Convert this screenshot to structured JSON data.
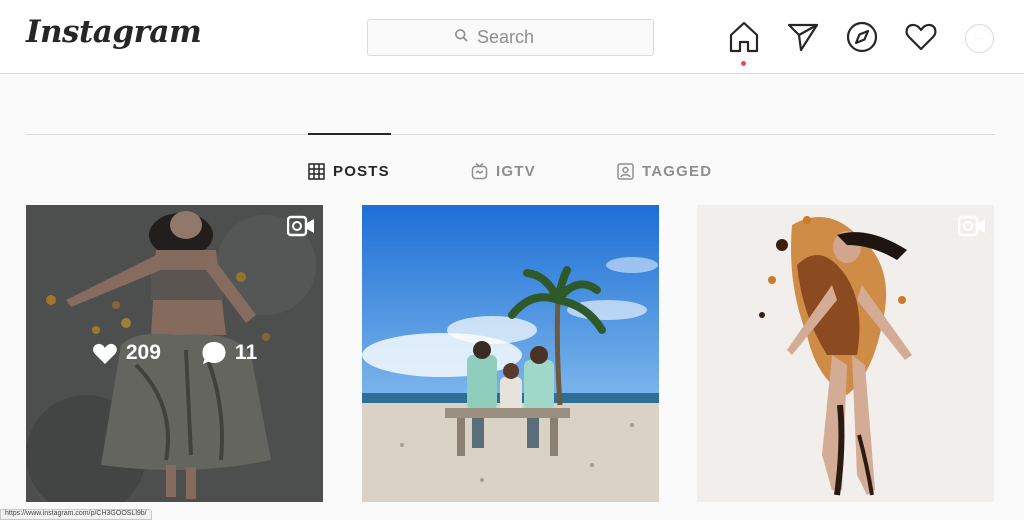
{
  "header": {
    "logo_text": "Instagram",
    "search": {
      "placeholder": "Search",
      "icon": "search-icon"
    },
    "nav_icons": [
      "home-icon",
      "direct-message-icon",
      "explore-icon",
      "activity-heart-icon",
      "profile-avatar"
    ],
    "home_notification_color": "#ed4956"
  },
  "tabs": [
    {
      "label": "POSTS",
      "icon": "grid-icon",
      "active": true
    },
    {
      "label": "IGTV",
      "icon": "igtv-icon",
      "active": false
    },
    {
      "label": "TAGGED",
      "icon": "tagged-icon",
      "active": false
    }
  ],
  "posts": [
    {
      "type": "video",
      "likes": "209",
      "comments": "11",
      "hover": true
    },
    {
      "type": "photo"
    },
    {
      "type": "video"
    }
  ],
  "status_bar": {
    "url": "https://www.instagram.com/p/CH3GOOSLl9b/"
  },
  "colors": {
    "text_primary": "#262626",
    "text_secondary": "#8e8e8e",
    "border": "#dbdbdb",
    "background": "#fafafa"
  }
}
